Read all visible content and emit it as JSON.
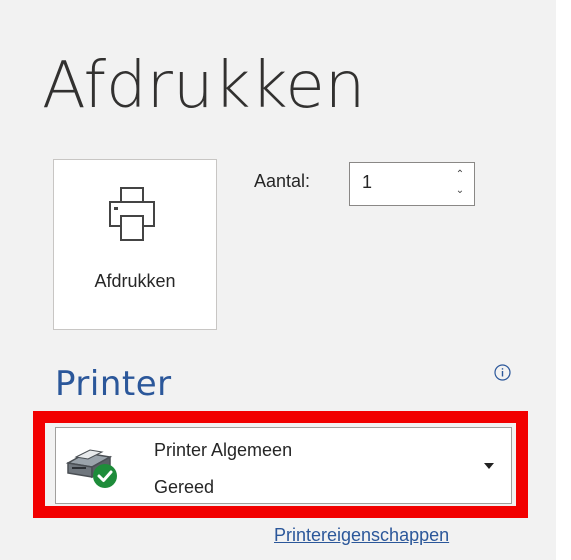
{
  "page": {
    "title": "Afdrukken"
  },
  "print_button": {
    "label": "Afdrukken",
    "icon": "printer-icon"
  },
  "copies": {
    "label": "Aantal:",
    "value": "1"
  },
  "printer_section": {
    "heading": "Printer",
    "info_icon": "info-icon",
    "selected_printer": {
      "name": "Printer Algemeen",
      "status": "Gereed",
      "icon": "printer-ready-icon"
    },
    "properties_link": "Printereigenschappen"
  },
  "colors": {
    "accent": "#2b579a",
    "highlight": "#f20000",
    "ready_green": "#1e8c3a",
    "background": "#f2f2f2"
  }
}
